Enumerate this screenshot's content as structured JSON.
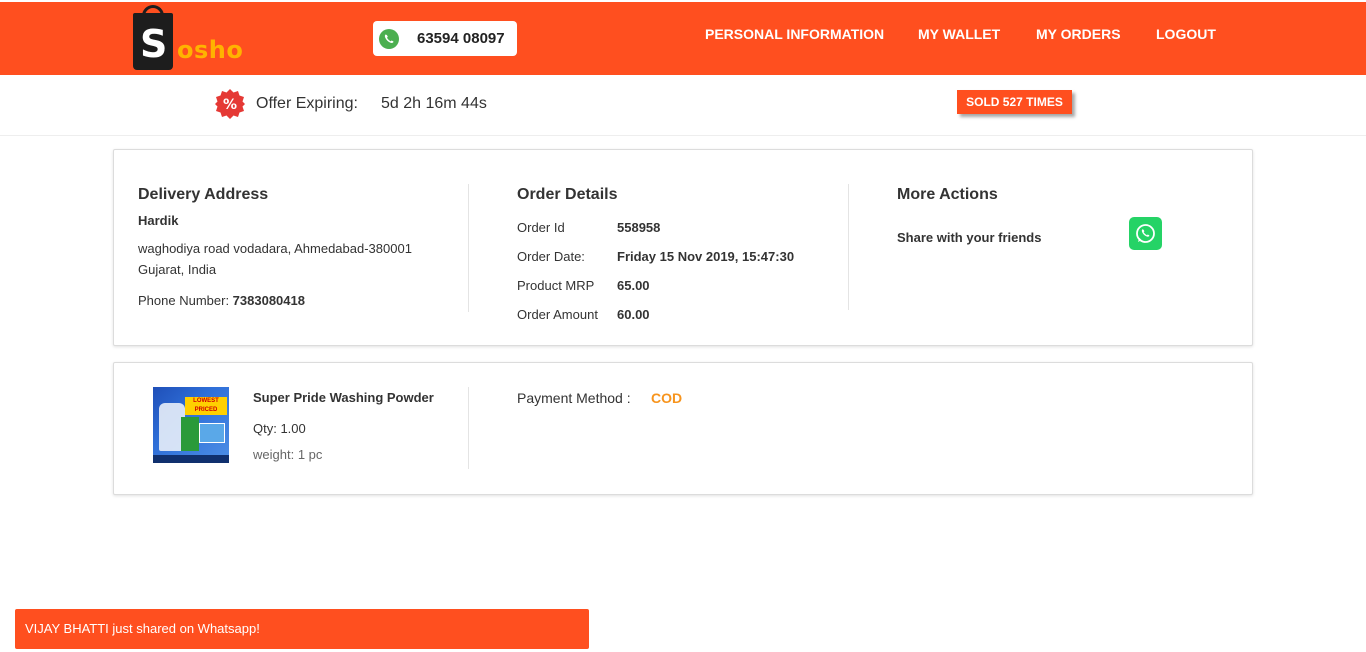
{
  "header": {
    "logo_first": "S",
    "logo_rest": "osho",
    "phone": "63594 08097",
    "nav": {
      "personal": "PERSONAL INFORMATION",
      "wallet": "MY WALLET",
      "orders": "MY ORDERS",
      "logout": "LOGOUT"
    },
    "brand_color": "#ff4f1f"
  },
  "offer": {
    "badge_symbol": "%",
    "label": "Offer Expiring:",
    "time": "5d 2h 16m 44s",
    "sold": "SOLD 527 TIMES"
  },
  "delivery": {
    "title": "Delivery Address",
    "name": "Hardik",
    "address_line1": "waghodiya road vodadara, Ahmedabad-380001",
    "address_line2": "Gujarat, India",
    "phone_label": "Phone Number: ",
    "phone_value": "7383080418"
  },
  "order": {
    "title": "Order Details",
    "rows": [
      {
        "label": "Order Id",
        "value": "558958"
      },
      {
        "label": "Order Date:",
        "value": "Friday 15 Nov 2019, 15:47:30"
      },
      {
        "label": "Product MRP",
        "value": "65.00"
      },
      {
        "label": "Order Amount",
        "value": "60.00"
      }
    ]
  },
  "actions": {
    "title": "More Actions",
    "share": "Share with your friends"
  },
  "product": {
    "name": "Super Pride Washing Powder",
    "qty_label": "Qty: ",
    "qty": "1.00",
    "weight_label": "weight: ",
    "weight": "1 pc",
    "image_tag": "LOWEST PRICED"
  },
  "payment": {
    "label": "Payment Method : ",
    "value": "COD",
    "value_color": "#f7941d"
  },
  "toast": "VIJAY BHATTI just shared on Whatsapp!"
}
